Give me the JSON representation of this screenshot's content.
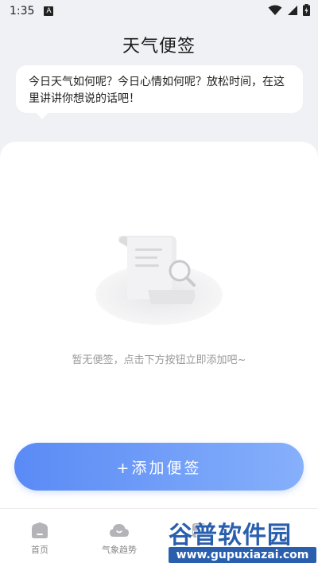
{
  "status_bar": {
    "time": "1:35",
    "notification_glyph": "A"
  },
  "header": {
    "title": "天气便签"
  },
  "bubble": {
    "text": "今日天气如何呢？今日心情如何呢？放松时间，在这里讲讲你想说的话吧！"
  },
  "empty_state": {
    "text": "暂无便签，点击下方按钮立即添加吧~",
    "icon": "empty-document-search-illustration"
  },
  "add_button": {
    "label": "+添加便签"
  },
  "nav": {
    "items": [
      {
        "label": "首页",
        "icon": "home-icon"
      },
      {
        "label": "气象趋势",
        "icon": "cloud-icon"
      },
      {
        "label": "",
        "icon": "note-icon"
      },
      {
        "label": "",
        "icon": "user-icon"
      }
    ]
  },
  "watermark": {
    "main": "谷普软件园",
    "url": "www.gupuxiazai.com"
  },
  "colors": {
    "accent_start": "#5a8af5",
    "accent_end": "#86b0fb",
    "watermark": "#2a5fae"
  }
}
